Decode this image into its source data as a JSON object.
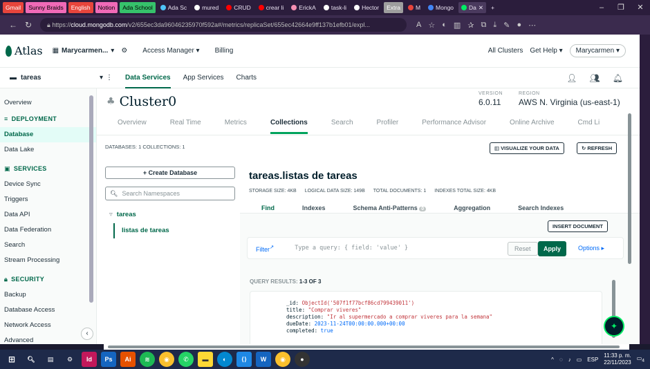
{
  "browser": {
    "bookmarks": [
      {
        "label": "Gmail",
        "color": "#e8453c",
        "kind": "tag"
      },
      {
        "label": "Sunny Braids",
        "color": "#f06ab7",
        "kind": "tag"
      },
      {
        "label": "English",
        "color": "#e8453c",
        "kind": "tag"
      },
      {
        "label": "Notion",
        "color": "#f06ab7",
        "kind": "tag"
      },
      {
        "label": "Ada School",
        "color": "#36c16b",
        "kind": "tag"
      }
    ],
    "tabs": [
      "Ada Sc",
      "mured",
      "CRUD",
      "crear li",
      "ErickA",
      "task-li",
      "Hector",
      "M",
      "Mongo",
      "Da"
    ],
    "extra_label": "Extra",
    "url_prefix": "https://",
    "url_host": "cloud.mongodb.com",
    "url_path": "/v2/655ec3da96046235970f592a#/metrics/replicaSet/655ec42664e9ff137b1efb01/expl..."
  },
  "atlas_nav": {
    "brand": "Atlas",
    "org": "Marycarmen...",
    "access_manager": "Access Manager",
    "billing": "Billing",
    "all_clusters": "All Clusters",
    "get_help": "Get Help",
    "user": "Marycarmen"
  },
  "project_bar": {
    "project": "tareas",
    "tabs": [
      "Data Services",
      "App Services",
      "Charts"
    ]
  },
  "sidebar": {
    "overview": "Overview",
    "deployment": "DEPLOYMENT",
    "database": "Database",
    "data_lake": "Data Lake",
    "services": "SERVICES",
    "device_sync": "Device Sync",
    "triggers": "Triggers",
    "data_api": "Data API",
    "data_federation": "Data Federation",
    "search": "Search",
    "stream_processing": "Stream Processing",
    "security": "SECURITY",
    "backup": "Backup",
    "database_access": "Database Access",
    "network_access": "Network Access",
    "advanced": "Advanced"
  },
  "cluster": {
    "name": "Cluster0",
    "version_label": "VERSION",
    "version": "6.0.11",
    "region_label": "REGION",
    "region": "AWS N. Virginia (us-east-1)",
    "tabs": [
      "Overview",
      "Real Time",
      "Metrics",
      "Collections",
      "Search",
      "Profiler",
      "Performance Advisor",
      "Online Archive",
      "Cmd Li"
    ],
    "summary": "DATABASES: 1  COLLECTIONS: 1",
    "visualize": "VISUALIZE YOUR DATA",
    "refresh": "REFRESH",
    "create_db": "+ Create Database",
    "search_placeholder": "Search Namespaces",
    "db_name": "tareas",
    "collection_name": "listas de tareas"
  },
  "collection": {
    "title": "tareas.listas de tareas",
    "storage": "STORAGE SIZE: 4KB",
    "logical": "LOGICAL DATA SIZE: 149B",
    "docs": "TOTAL DOCUMENTS: 1",
    "indexes_size": "INDEXES TOTAL SIZE: 4KB",
    "tabs": [
      "Find",
      "Indexes",
      "Schema Anti-Patterns",
      "Aggregation",
      "Search Indexes"
    ],
    "schema_badge": "0",
    "insert": "INSERT DOCUMENT",
    "filter_label": "Filter",
    "filter_placeholder": "Type a query: { field: 'value' }",
    "reset": "Reset",
    "apply": "Apply",
    "options": "Options",
    "query_results_label": "QUERY RESULTS:",
    "query_results_count": "1-3 OF 3",
    "doc": {
      "id_key": "_id:",
      "id_val": "ObjectId('507f1f77bcf86cd799439011')",
      "title_key": "title:",
      "title_val": "\"Comprar viveres\"",
      "desc_key": "description:",
      "desc_val": "\"Ir al supermercado a comprar viveres para la semana\"",
      "due_key": "dueDate:",
      "due_val": "2023-11-24T00:00:00.000+00:00",
      "completed_key": "completed:",
      "completed_val": "true"
    }
  },
  "taskbar": {
    "apps": [
      {
        "label": "Id",
        "color": "#c2185b"
      },
      {
        "label": "Ps",
        "color": "#1565c0"
      },
      {
        "label": "Ai",
        "color": "#e65100"
      }
    ],
    "lang": "ESP",
    "time": "11:33 p. m.",
    "date": "22/11/2023",
    "badge": "4"
  }
}
